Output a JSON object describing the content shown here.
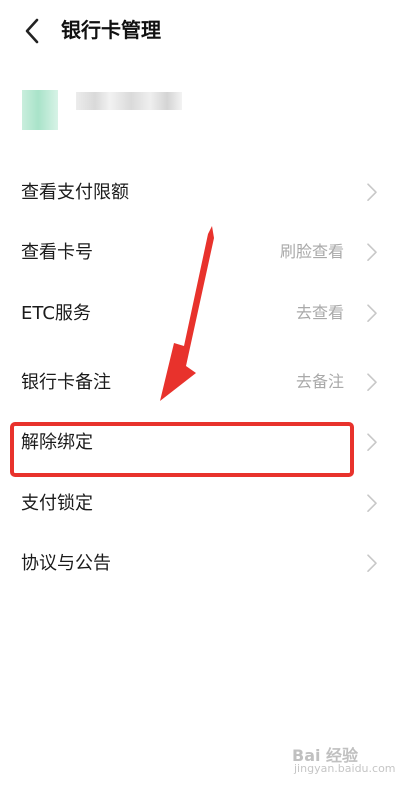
{
  "header": {
    "back_icon": "chevron-left-icon",
    "title": "银行卡管理"
  },
  "menu": {
    "items": [
      {
        "label": "查看支付限额",
        "value": ""
      },
      {
        "label": "查看卡号",
        "value": "刷脸查看"
      },
      {
        "label": "ETC服务",
        "value": "去查看"
      },
      {
        "label": "银行卡备注",
        "value": "去备注"
      },
      {
        "label": "解除绑定",
        "value": ""
      },
      {
        "label": "支付锁定",
        "value": ""
      },
      {
        "label": "协议与公告",
        "value": ""
      }
    ],
    "chevron_icon": "chevron-right-icon"
  },
  "annotation": {
    "color": "#e8322c",
    "arrow_icon": "red-arrow-icon"
  },
  "watermark": {
    "brand": "Bai 经验",
    "sub": "jingyan.baidu.com"
  },
  "colors": {
    "text": "#1b1b1b",
    "secondary": "#a9a9a9",
    "chevron": "#c8c8c8",
    "logo": "#a9e3c9"
  }
}
